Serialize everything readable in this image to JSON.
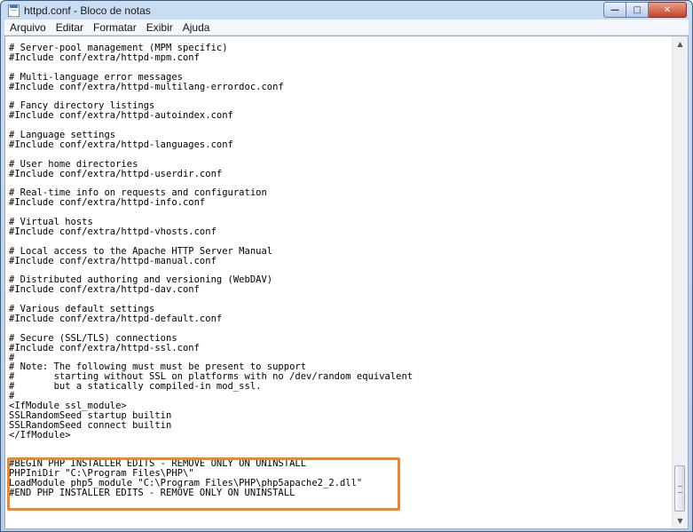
{
  "window": {
    "title": "httpd.conf - Bloco de notas",
    "minimize_glyph": "—",
    "maximize_glyph": "□",
    "close_glyph": "✕"
  },
  "menu": {
    "items": [
      "Arquivo",
      "Editar",
      "Formatar",
      "Exibir",
      "Ajuda"
    ]
  },
  "editor": {
    "lines": [
      "# Server-pool management (MPM specific)",
      "#Include conf/extra/httpd-mpm.conf",
      "",
      "# Multi-language error messages",
      "#Include conf/extra/httpd-multilang-errordoc.conf",
      "",
      "# Fancy directory listings",
      "#Include conf/extra/httpd-autoindex.conf",
      "",
      "# Language settings",
      "#Include conf/extra/httpd-languages.conf",
      "",
      "# User home directories",
      "#Include conf/extra/httpd-userdir.conf",
      "",
      "# Real-time info on requests and configuration",
      "#Include conf/extra/httpd-info.conf",
      "",
      "# Virtual hosts",
      "#Include conf/extra/httpd-vhosts.conf",
      "",
      "# Local access to the Apache HTTP Server Manual",
      "#Include conf/extra/httpd-manual.conf",
      "",
      "# Distributed authoring and versioning (WebDAV)",
      "#Include conf/extra/httpd-dav.conf",
      "",
      "# Various default settings",
      "#Include conf/extra/httpd-default.conf",
      "",
      "# Secure (SSL/TLS) connections",
      "#Include conf/extra/httpd-ssl.conf",
      "#",
      "# Note: The following must must be present to support",
      "#       starting without SSL on platforms with no /dev/random equivalent",
      "#       but a statically compiled-in mod_ssl.",
      "#",
      "<IfModule ssl_module>",
      "SSLRandomSeed startup builtin",
      "SSLRandomSeed connect builtin",
      "</IfModule>",
      "",
      "",
      "#BEGIN PHP INSTALLER EDITS - REMOVE ONLY ON UNINSTALL",
      "PHPIniDir \"C:\\Program Files\\PHP\\\"",
      "LoadModule php5_module \"C:\\Program Files\\PHP\\php5apache2_2.dll\"",
      "#END PHP INSTALLER EDITS - REMOVE ONLY ON UNINSTALL"
    ]
  },
  "highlight_color": "#f0862c"
}
